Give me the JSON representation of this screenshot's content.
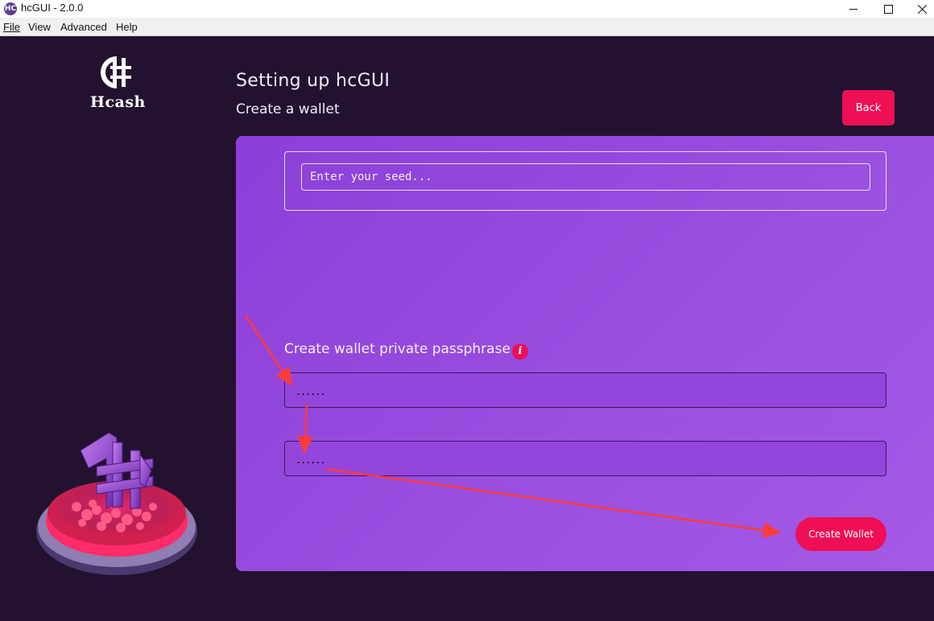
{
  "window": {
    "title": "hcGUI - 2.0.0",
    "app_icon_glyph": "HC"
  },
  "menubar": {
    "file": "File",
    "view": "View",
    "advanced": "Advanced",
    "help": "Help"
  },
  "sidebar": {
    "brand_name": "Hcash"
  },
  "header": {
    "title": "Setting up hcGUI",
    "subtitle": "Create a wallet",
    "back_label": "Back"
  },
  "form": {
    "seed_placeholder": "Enter your seed...",
    "passphrase_label": "Create wallet private passphrase",
    "info_glyph": "i",
    "passphrase_value": "......",
    "confirm_value": "......",
    "create_label": "Create Wallet"
  },
  "colors": {
    "background": "#22122f",
    "panel": "#9a4fe0",
    "accent": "#ee0f55",
    "annotation_arrow": "#ff3b3b"
  },
  "icons": {
    "app": "hcash-logo-icon",
    "minimize": "minimize-icon",
    "maximize": "maximize-icon",
    "close": "close-icon",
    "info": "info-icon"
  }
}
